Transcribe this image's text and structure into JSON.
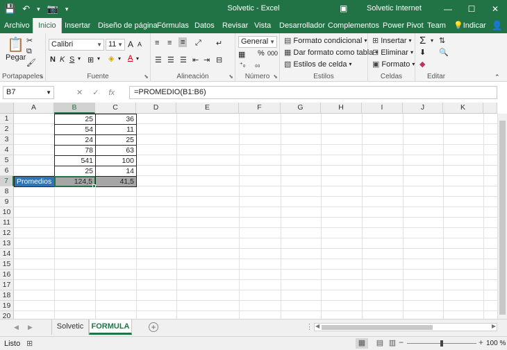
{
  "window": {
    "title": "Solvetic  -  Excel",
    "account": "Solvetic Internet",
    "minimize_glyph": "—",
    "maximize_glyph": "☐",
    "close_glyph": "✕",
    "ribbon_options_glyph": "▣"
  },
  "qat": {
    "save_icon": "💾",
    "undo_icon": "↶",
    "undo_arrow": "▾",
    "camera_icon": "📷",
    "customize_icon": "▾"
  },
  "tabs": [
    {
      "label": "Archivo"
    },
    {
      "label": "Inicio"
    },
    {
      "label": "Insertar"
    },
    {
      "label": "Diseño de página"
    },
    {
      "label": "Fórmulas"
    },
    {
      "label": "Datos"
    },
    {
      "label": "Revisar"
    },
    {
      "label": "Vista"
    },
    {
      "label": "Desarrollador"
    },
    {
      "label": "Complementos"
    },
    {
      "label": "Power Pivot"
    },
    {
      "label": "Team"
    },
    {
      "label": "Indicar"
    }
  ],
  "ribbon": {
    "portapapeles": {
      "label": "Portapapeles",
      "paste": "Pegar"
    },
    "fuente": {
      "label": "Fuente",
      "font_name": "Calibri",
      "font_size": "11",
      "grow": "A",
      "shrink": "A",
      "bold": "N",
      "italic": "K",
      "underline": "S"
    },
    "alineacion": {
      "label": "Alineación"
    },
    "numero": {
      "label": "Número",
      "format": "General",
      "percent": "%",
      "thousands": "000"
    },
    "estilos": {
      "label": "Estilos",
      "conditional": "Formato condicional",
      "as_table": "Dar formato como tabla",
      "cell_styles": "Estilos de celda"
    },
    "celdas": {
      "label": "Celdas",
      "insert": "Insertar",
      "delete": "Eliminar",
      "format": "Formato"
    },
    "editar": {
      "label": "Editar"
    }
  },
  "formula_bar": {
    "name_box": "B7",
    "cancel": "✕",
    "enter": "✓",
    "fx": "fx",
    "formula": "=PROMEDIO(B1:B6)"
  },
  "grid": {
    "columns": [
      "A",
      "B",
      "C",
      "D",
      "E",
      "F",
      "G",
      "H",
      "I",
      "J",
      "K"
    ],
    "rows": [
      "1",
      "2",
      "3",
      "4",
      "5",
      "6",
      "7",
      "8",
      "9",
      "10",
      "11",
      "12",
      "13",
      "14",
      "15",
      "16",
      "17",
      "18",
      "19",
      "20"
    ],
    "selected_cell": "B7",
    "data": {
      "B": [
        "25",
        "54",
        "24",
        "78",
        "541",
        "25"
      ],
      "C": [
        "36",
        "11",
        "25",
        "63",
        "100",
        "14"
      ]
    },
    "row7": {
      "A": "Promedios",
      "B": "124,5",
      "C": "41,5"
    },
    "colors": {
      "highlight_blue": "#2e75b6",
      "avg_gray": "#a6a6a6",
      "excel_green": "#217346"
    }
  },
  "sheets": [
    {
      "label": "Solvetic",
      "active": false
    },
    {
      "label": "FORMULA",
      "active": true
    }
  ],
  "sheet_nav": {
    "prev": "◀",
    "next": "▶",
    "add": "+",
    "more": "⋮"
  },
  "status": {
    "ready": "Listo",
    "macro_icon": "⊞",
    "zoom": "100 %",
    "zoom_out": "−",
    "zoom_in": "+",
    "view_normal": "▦",
    "view_layout": "▤",
    "view_pagebreak": "▥"
  }
}
